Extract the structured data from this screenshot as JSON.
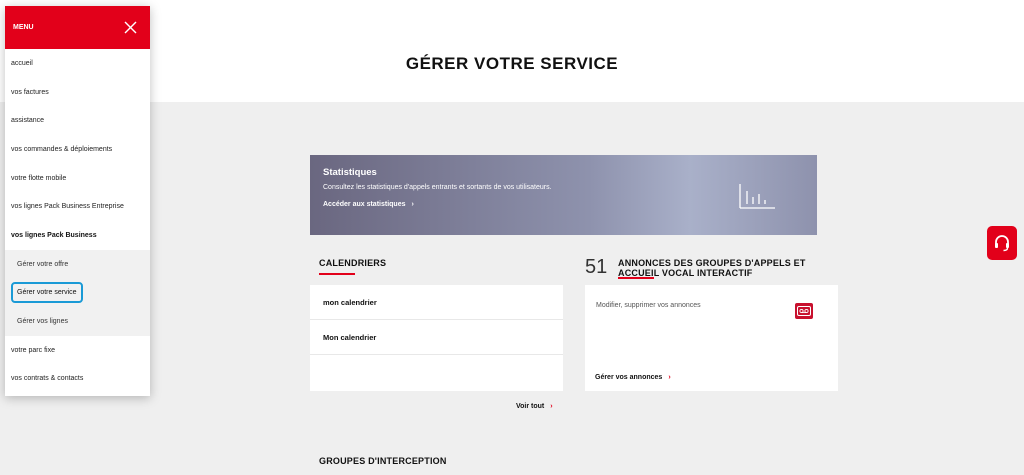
{
  "page": {
    "title": "GÉRER VOTRE SERVICE"
  },
  "menu": {
    "title": "MENU",
    "items": [
      {
        "label": "accueil"
      },
      {
        "label": "vos factures"
      },
      {
        "label": "assistance"
      },
      {
        "label": "vos commandes & déploiements"
      },
      {
        "label": "votre flotte mobile"
      },
      {
        "label": "vos lignes Pack Business Entreprise"
      },
      {
        "label": "vos lignes Pack Business"
      },
      {
        "label": "Gérer votre offre"
      },
      {
        "label": "Gérer votre service"
      },
      {
        "label": "Gérer vos lignes"
      },
      {
        "label": "votre parc fixe"
      },
      {
        "label": "vos contrats & contacts"
      }
    ]
  },
  "stats": {
    "title": "Statistiques",
    "description": "Consultez les statistiques d'appels entrants et sortants de vos utilisateurs.",
    "link": "Accéder aux statistiques"
  },
  "calendriers": {
    "title": "CALENDRIERS",
    "rows": [
      "mon calendrier",
      "Mon calendrier"
    ],
    "voir_tout": "Voir tout"
  },
  "annonces": {
    "count": "51",
    "title_line1": "ANNONCES DES GROUPES D'APPELS ET",
    "title_line2": "ACCUEIL VOCAL INTERACTIF",
    "description": "Modifier, supprimer vos annonces",
    "link": "Gérer vos annonces"
  },
  "interception": {
    "title": "GROUPES D'INTERCEPTION"
  },
  "colors": {
    "brand_red": "#e2001a",
    "focus_blue": "#1a9ad6"
  }
}
